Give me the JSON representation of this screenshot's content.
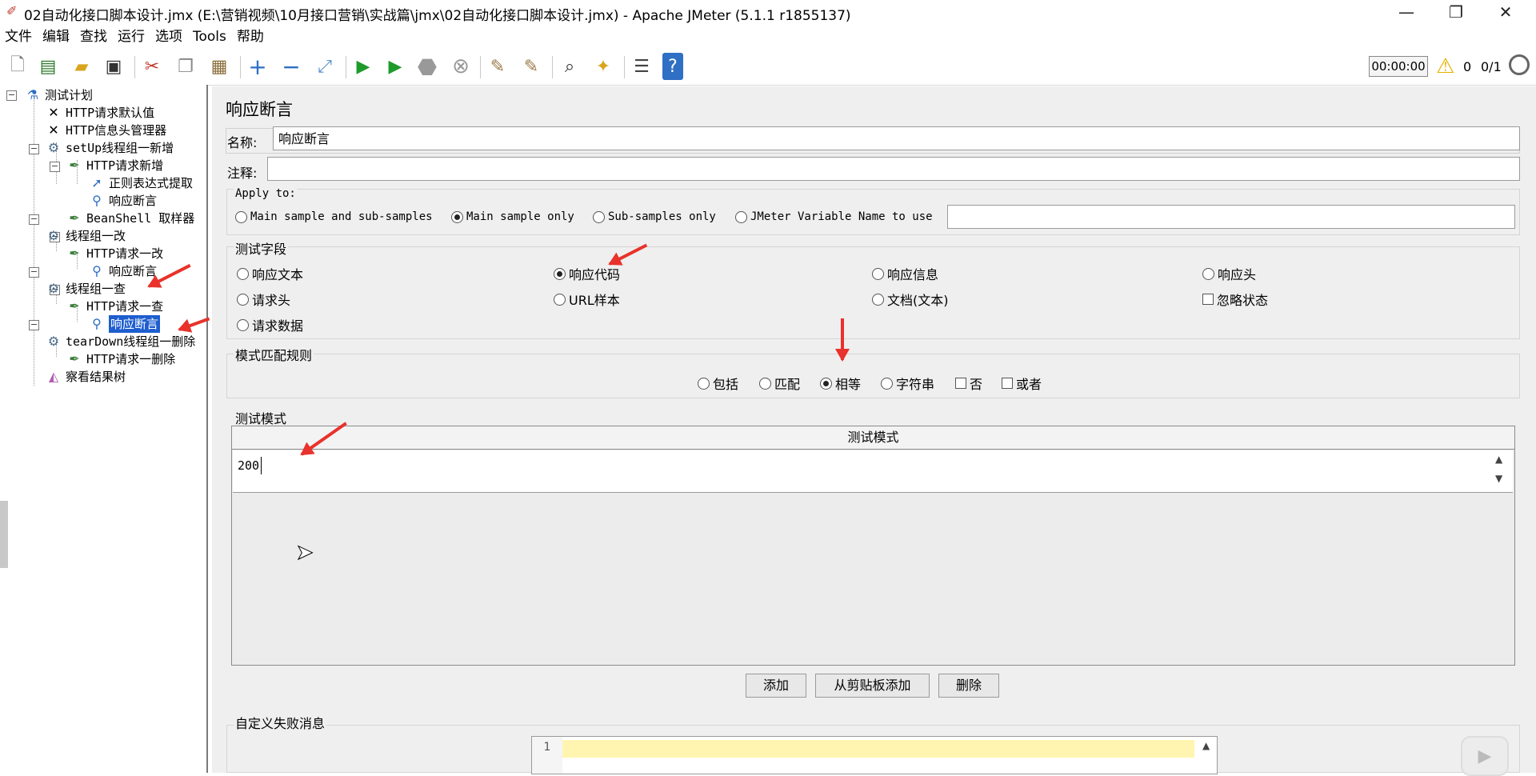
{
  "window": {
    "title": "02自动化接口脚本设计.jmx (E:\\营销视频\\10月接口营销\\实战篇\\jmx\\02自动化接口脚本设计.jmx) - Apache JMeter (5.1.1 r1855137)",
    "minimize": "—",
    "maximize": "❐",
    "close": "✕"
  },
  "menu": [
    "文件",
    "编辑",
    "查找",
    "运行",
    "选项",
    "Tools",
    "帮助"
  ],
  "toolbar": {
    "timer": "00:00:00",
    "warning_count": "0",
    "threads": "0/1"
  },
  "tree": [
    {
      "label": "测试计划"
    },
    {
      "label": "HTTP请求默认值"
    },
    {
      "label": "HTTP信息头管理器"
    },
    {
      "label": "setUp线程组一新增"
    },
    {
      "label": "HTTP请求新增"
    },
    {
      "label": "正则表达式提取"
    },
    {
      "label": "响应断言"
    },
    {
      "label": "BeanShell 取样器"
    },
    {
      "label": "线程组一改"
    },
    {
      "label": "HTTP请求一改"
    },
    {
      "label": "响应断言"
    },
    {
      "label": "线程组一查"
    },
    {
      "label": "HTTP请求一查"
    },
    {
      "label": "响应断言"
    },
    {
      "label": "tearDown线程组一删除"
    },
    {
      "label": "HTTP请求一删除"
    },
    {
      "label": "察看结果树"
    }
  ],
  "panel": {
    "title": "响应断言",
    "name_label": "名称:",
    "name_value": "响应断言",
    "comment_label": "注释:",
    "comment_value": "",
    "apply_to": {
      "label": "Apply to:",
      "options": [
        "Main sample and sub-samples",
        "Main sample only",
        "Sub-samples only",
        "JMeter Variable Name to use"
      ],
      "selected": "Main sample only",
      "variable_value": ""
    },
    "test_field": {
      "label": "测试字段",
      "options": [
        "响应文本",
        "响应代码",
        "响应信息",
        "响应头",
        "请求头",
        "URL样本",
        "文档(文本)",
        "请求数据"
      ],
      "checkbox": "忽略状态",
      "selected": "响应代码"
    },
    "match_rules": {
      "label": "模式匹配规则",
      "options": [
        "包括",
        "匹配",
        "相等",
        "字符串"
      ],
      "checkboxes": [
        "否",
        "或者"
      ],
      "selected": "相等"
    },
    "patterns": {
      "label": "测试模式",
      "column": "测试模式",
      "rows": [
        "200"
      ]
    },
    "buttons": {
      "add": "添加",
      "add_clipboard": "从剪贴板添加",
      "delete": "删除"
    },
    "custom_failure": {
      "label": "自定义失败消息",
      "line_number": "1"
    }
  }
}
